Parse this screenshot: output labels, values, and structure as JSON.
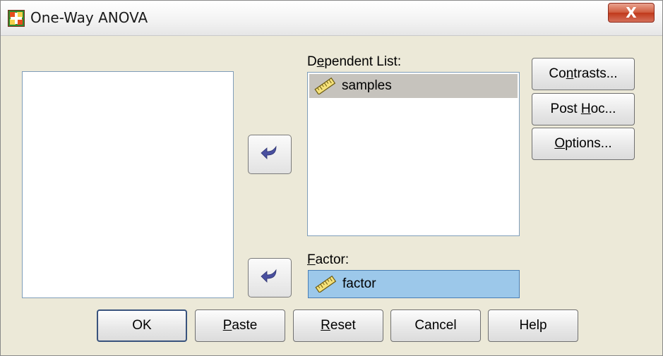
{
  "window": {
    "title": "One-Way ANOVA",
    "close_label": "X"
  },
  "dependent": {
    "label_before": "D",
    "label_underline": "e",
    "label_after": "pendent List:",
    "items": [
      "samples"
    ]
  },
  "factor": {
    "label_underline": "F",
    "label_after": "actor:",
    "value": "factor"
  },
  "side_buttons": {
    "contrasts_before": "Co",
    "contrasts_underline": "n",
    "contrasts_after": "trasts...",
    "posthoc_before": "Post ",
    "posthoc_underline": "H",
    "posthoc_after": "oc...",
    "options_underline": "O",
    "options_after": "ptions..."
  },
  "bottom_buttons": {
    "ok": "OK",
    "paste_underline": "P",
    "paste_after": "aste",
    "reset_underline": "R",
    "reset_after": "eset",
    "cancel": "Cancel",
    "help": "Help"
  },
  "icons": {
    "app": "spss-dialog-icon",
    "variable": "ruler-scale-icon",
    "move": "curved-arrow-left-icon"
  },
  "colors": {
    "dialog_bg": "#ece9d8",
    "selected_item": "#c6c3bd",
    "factor_bg": "#9cc8ea",
    "arrow": "#4a50a0",
    "close_red": "#c0391b"
  }
}
